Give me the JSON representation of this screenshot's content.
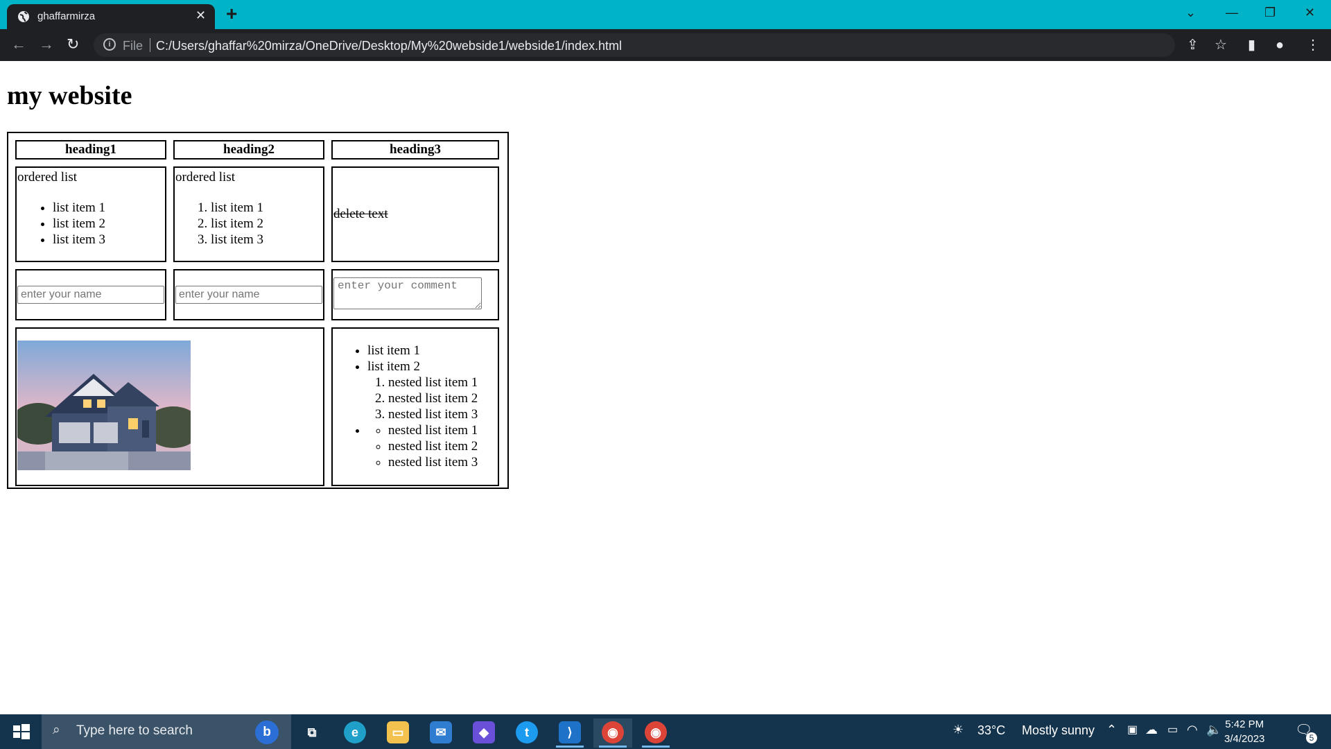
{
  "browser": {
    "tab_title": "ghaffarmirza",
    "address_scheme": "File",
    "url": "C:/Users/ghaffar%20mirza/OneDrive/Desktop/My%20webside1/webside1/index.html"
  },
  "page": {
    "title": "my website",
    "headings": [
      "heading1",
      "heading2",
      "heading3"
    ],
    "col1": {
      "caption": "ordered list",
      "items": [
        "list item 1",
        "list item 2",
        "list item 3"
      ]
    },
    "col2": {
      "caption": "ordered list",
      "items": [
        "list item 1",
        "list item 2",
        "list item 3"
      ]
    },
    "col3": {
      "strike_text": "delete text"
    },
    "inputs": {
      "name_placeholder": "enter your name",
      "comment_placeholder": "enter your comment"
    },
    "nested_list": {
      "items": [
        "list item 1",
        "list item 2"
      ],
      "ordered": [
        "nested list item 1",
        "nested list item 2",
        "nested list item 3"
      ],
      "unordered": [
        "nested list item 1",
        "nested list item 2",
        "nested list item 3"
      ]
    }
  },
  "taskbar": {
    "search_placeholder": "Type here to search",
    "weather_temp": "33°C",
    "weather_text": "Mostly sunny",
    "time": "5:42 PM",
    "date": "3/4/2023",
    "notification_count": "5"
  },
  "colors": {
    "tabbar": "#01b3c6",
    "chrome_dark": "#1f2023",
    "taskbar": "#14334c"
  }
}
